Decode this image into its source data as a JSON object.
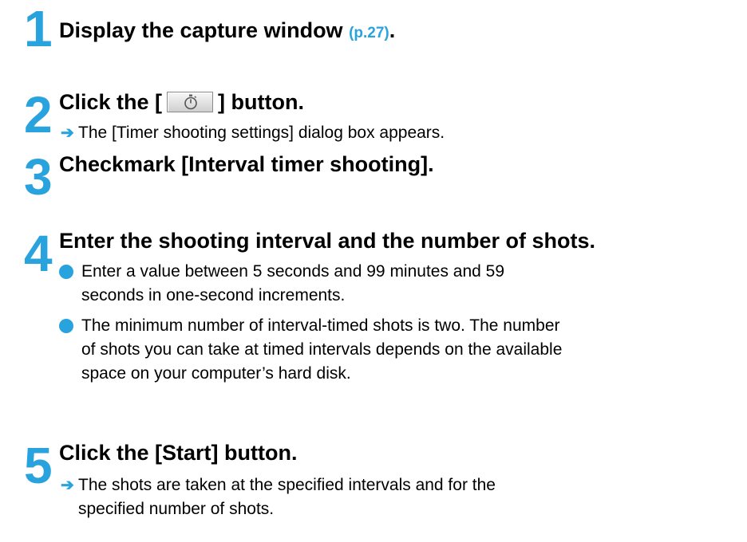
{
  "steps": [
    {
      "number": "1",
      "title": "Display the capture window",
      "reference": "(p.27)",
      "title_end": "."
    },
    {
      "number": "2",
      "title_prefix": "Click the [",
      "button_icon": "stopwatch-icon",
      "title_suffix": "] button.",
      "result": "The [Timer shooting settings] dialog box appears."
    },
    {
      "number": "3",
      "title": "Checkmark [Interval timer shooting]."
    },
    {
      "number": "4",
      "title": "Enter the shooting interval and the number of shots.",
      "bullets": [
        {
          "line1": "Enter a value between 5 seconds and 99 minutes and 59",
          "line2": "seconds in one-second increments."
        },
        {
          "line1": "The minimum number of interval-timed shots is two. The number",
          "line2": "of shots you can take at timed intervals depends on the available",
          "line3": "space on your computer’s hard disk."
        }
      ]
    },
    {
      "number": "5",
      "title": "Click the [Start] button.",
      "result_line1": "The shots are taken at the specified intervals and for the",
      "result_line2": "specified number of shots."
    }
  ],
  "colors": {
    "accent": "#29a3dd",
    "text": "#000000"
  },
  "result_arrow": "➔"
}
